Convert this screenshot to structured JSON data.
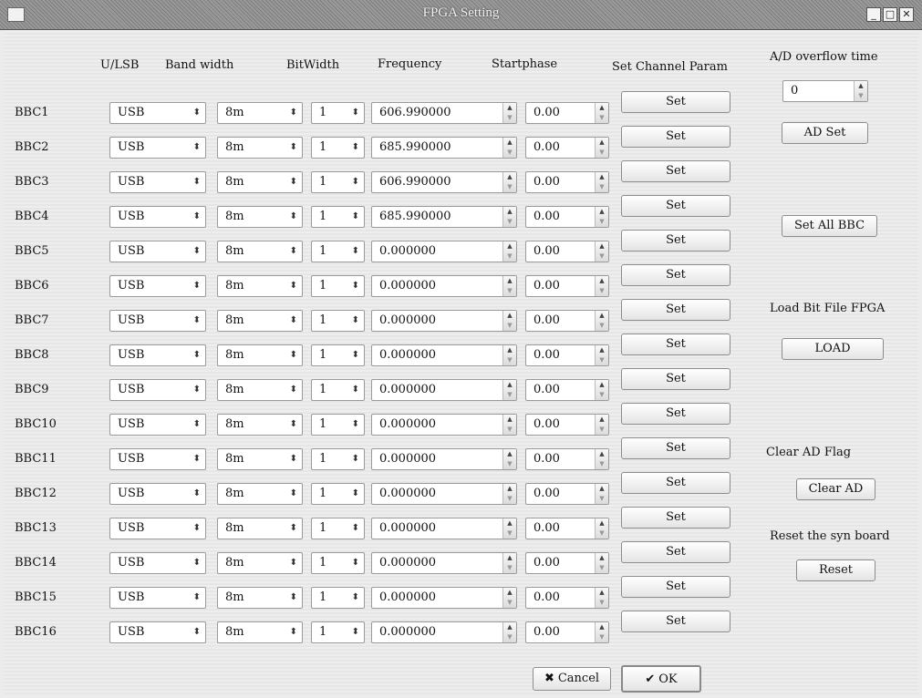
{
  "window": {
    "title": "FPGA Setting",
    "controls": [
      "minimize",
      "maximize",
      "close"
    ]
  },
  "headers": {
    "ulsb": "U/LSB",
    "bandwidth": "Band width",
    "bitwidth": "BitWidth",
    "frequency": "Frequency",
    "startphase": "Startphase",
    "set_channel_param": "Set Channel Param"
  },
  "rows": [
    {
      "label": "BBC1",
      "ulsb": "USB",
      "bandwidth": "8m",
      "bitwidth": "1",
      "frequency": "606.990000",
      "startphase": "0.00",
      "set": "Set"
    },
    {
      "label": "BBC2",
      "ulsb": "USB",
      "bandwidth": "8m",
      "bitwidth": "1",
      "frequency": "685.990000",
      "startphase": "0.00",
      "set": "Set"
    },
    {
      "label": "BBC3",
      "ulsb": "USB",
      "bandwidth": "8m",
      "bitwidth": "1",
      "frequency": "606.990000",
      "startphase": "0.00",
      "set": "Set"
    },
    {
      "label": "BBC4",
      "ulsb": "USB",
      "bandwidth": "8m",
      "bitwidth": "1",
      "frequency": "685.990000",
      "startphase": "0.00",
      "set": "Set"
    },
    {
      "label": "BBC5",
      "ulsb": "USB",
      "bandwidth": "8m",
      "bitwidth": "1",
      "frequency": "0.000000",
      "startphase": "0.00",
      "set": "Set"
    },
    {
      "label": "BBC6",
      "ulsb": "USB",
      "bandwidth": "8m",
      "bitwidth": "1",
      "frequency": "0.000000",
      "startphase": "0.00",
      "set": "Set"
    },
    {
      "label": "BBC7",
      "ulsb": "USB",
      "bandwidth": "8m",
      "bitwidth": "1",
      "frequency": "0.000000",
      "startphase": "0.00",
      "set": "Set"
    },
    {
      "label": "BBC8",
      "ulsb": "USB",
      "bandwidth": "8m",
      "bitwidth": "1",
      "frequency": "0.000000",
      "startphase": "0.00",
      "set": "Set"
    },
    {
      "label": "BBC9",
      "ulsb": "USB",
      "bandwidth": "8m",
      "bitwidth": "1",
      "frequency": "0.000000",
      "startphase": "0.00",
      "set": "Set"
    },
    {
      "label": "BBC10",
      "ulsb": "USB",
      "bandwidth": "8m",
      "bitwidth": "1",
      "frequency": "0.000000",
      "startphase": "0.00",
      "set": "Set"
    },
    {
      "label": "BBC11",
      "ulsb": "USB",
      "bandwidth": "8m",
      "bitwidth": "1",
      "frequency": "0.000000",
      "startphase": "0.00",
      "set": "Set"
    },
    {
      "label": "BBC12",
      "ulsb": "USB",
      "bandwidth": "8m",
      "bitwidth": "1",
      "frequency": "0.000000",
      "startphase": "0.00",
      "set": "Set"
    },
    {
      "label": "BBC13",
      "ulsb": "USB",
      "bandwidth": "8m",
      "bitwidth": "1",
      "frequency": "0.000000",
      "startphase": "0.00",
      "set": "Set"
    },
    {
      "label": "BBC14",
      "ulsb": "USB",
      "bandwidth": "8m",
      "bitwidth": "1",
      "frequency": "0.000000",
      "startphase": "0.00",
      "set": "Set"
    },
    {
      "label": "BBC15",
      "ulsb": "USB",
      "bandwidth": "8m",
      "bitwidth": "1",
      "frequency": "0.000000",
      "startphase": "0.00",
      "set": "Set"
    },
    {
      "label": "BBC16",
      "ulsb": "USB",
      "bandwidth": "8m",
      "bitwidth": "1",
      "frequency": "0.000000",
      "startphase": "0.00",
      "set": "Set"
    }
  ],
  "side": {
    "ad_overflow_label": "A/D overflow time",
    "ad_overflow_value": "0",
    "ad_set": "AD Set",
    "set_all_bbc": "Set All BBC",
    "load_bit_label": "Load Bit File FPGA",
    "load": "LOAD",
    "clear_ad_flag_label": "Clear AD Flag",
    "clear_ad": "Clear AD",
    "reset_syn_label": "Reset the syn board",
    "reset": "Reset"
  },
  "footer": {
    "cancel": "Cancel",
    "ok": "OK"
  },
  "icons": {
    "combo": "updown-arrows-icon",
    "spin": "spin-arrows-icon",
    "cancel": "x-icon",
    "ok": "check-icon"
  }
}
